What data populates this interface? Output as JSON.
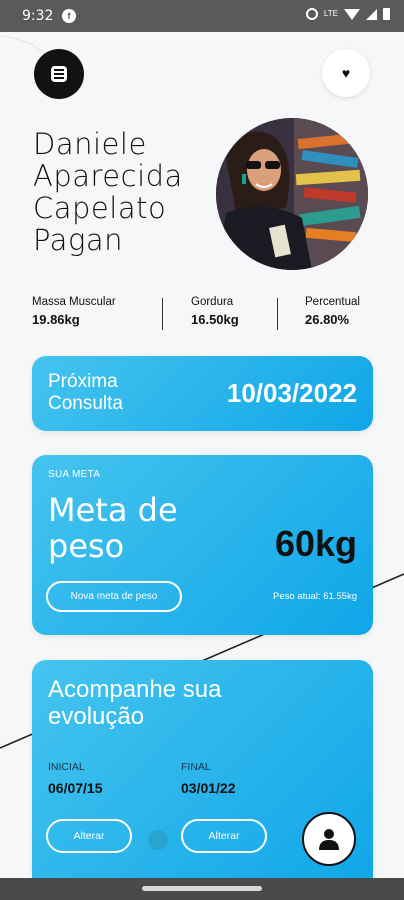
{
  "status_bar": {
    "time": "9:32",
    "app_icon": "facebook-icon",
    "icons": [
      "alarm-icon",
      "lte-icon",
      "wifi-icon",
      "signal-icon",
      "battery-icon"
    ],
    "lte_label": "LTE"
  },
  "header": {
    "menu_icon": "menu-icon",
    "favorite_icon": "heart-icon",
    "favorite_glyph": "♥"
  },
  "profile": {
    "name": "Daniele Aparecida Capelato Pagan",
    "photo": "profile-photo"
  },
  "stats": [
    {
      "label": "Massa Muscular",
      "value": "19.86kg"
    },
    {
      "label": "Gordura",
      "value": "16.50kg"
    },
    {
      "label": "Percentual",
      "value": "26.80%"
    }
  ],
  "consulta": {
    "label": "Próxima Consulta",
    "date": "10/03/2022"
  },
  "meta": {
    "small_label": "SUA META",
    "title": "Meta de peso",
    "goal": "60kg",
    "button_label": "Nova meta de peso",
    "current_weight": "Peso atual: 61.55kg"
  },
  "evolucao": {
    "title": "Acompanhe sua evolução",
    "inicial_label": "INICIAL",
    "inicial_value": "06/07/15",
    "final_label": "FINAL",
    "final_value": "03/01/22",
    "button_left": "Alterar",
    "button_right": "Alterar"
  },
  "colors": {
    "card_gradient_start": "#45c4ee",
    "card_gradient_end": "#0fa6e8",
    "dark": "#121212"
  }
}
